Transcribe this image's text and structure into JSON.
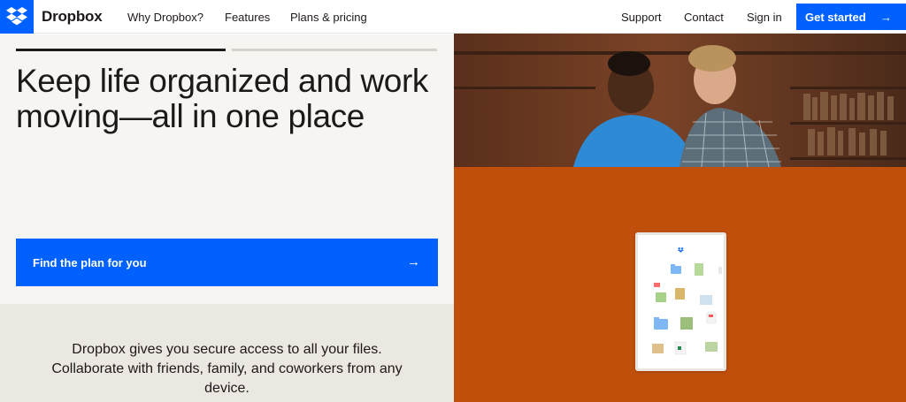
{
  "nav": {
    "brand": "Dropbox",
    "links": [
      "Why Dropbox?",
      "Features",
      "Plans & pricing"
    ],
    "right_links": [
      "Support",
      "Contact",
      "Sign in"
    ],
    "cta_label": "Get started"
  },
  "hero": {
    "headline": "Keep life organized and work moving—all in one place",
    "cta_label": "Find the plan for you",
    "description": "Dropbox gives you secure access to all your files. Collaborate with friends, family, and coworkers from any device."
  },
  "colors": {
    "accent": "#0061fe",
    "panel_orange": "#c04f0c",
    "hero_bg": "#f7f5f2",
    "text": "#1e1919"
  },
  "icons": [
    "dropbox-logo-icon",
    "arrow-right-icon",
    "folder-icon",
    "image-thumbnail-icon",
    "pdf-file-icon",
    "spreadsheet-file-icon"
  ]
}
